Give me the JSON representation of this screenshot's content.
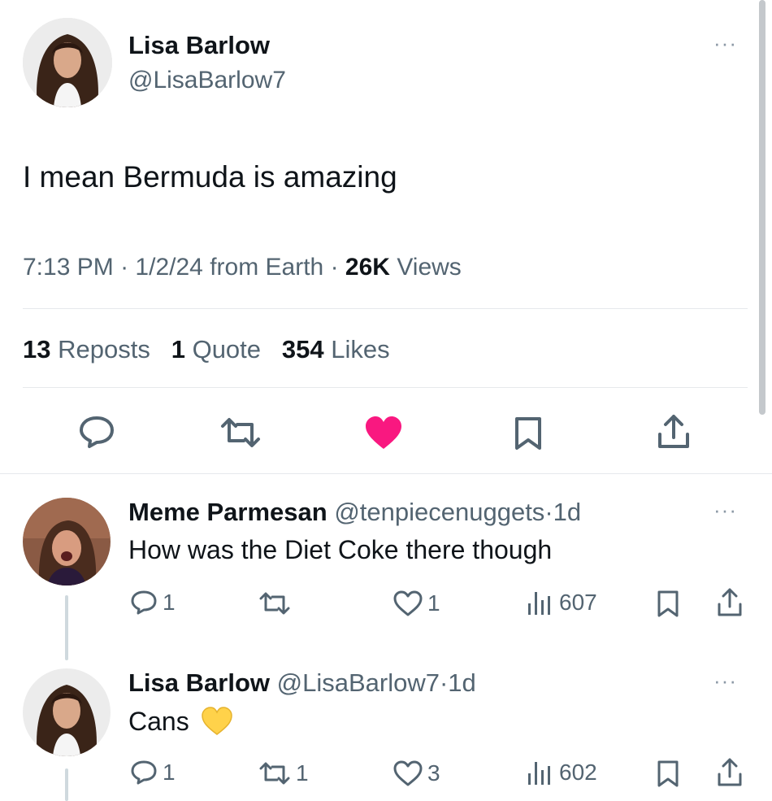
{
  "main_tweet": {
    "author_name": "Lisa Barlow",
    "handle": "@LisaBarlow7",
    "text": "I mean Bermuda is amazing",
    "time": "7:13 PM",
    "date": "1/2/24",
    "source": "from Earth",
    "views_count": "26K",
    "views_label": "Views",
    "reposts_count": "13",
    "reposts_label": "Reposts",
    "quotes_count": "1",
    "quotes_label": "Quote",
    "likes_count": "354",
    "likes_label": "Likes",
    "liked": true
  },
  "replies": [
    {
      "author_name": "Meme Parmesan",
      "handle": "@tenpiecenuggets",
      "age": "1d",
      "text": "How was the Diet Coke there though",
      "replies_count": "1",
      "reposts_count": "",
      "likes_count": "1",
      "views_count": "607"
    },
    {
      "author_name": "Lisa Barlow",
      "handle": "@LisaBarlow7",
      "age": "1d",
      "text": "Cans",
      "emoji": "yellow-heart",
      "replies_count": "1",
      "reposts_count": "1",
      "likes_count": "3",
      "views_count": "602"
    }
  ],
  "colors": {
    "like_pink": "#f91880",
    "text": "#0f1419",
    "muted": "#536471",
    "heart_yellow": "#ffd24a"
  },
  "more_glyph": "···",
  "separator": "·"
}
